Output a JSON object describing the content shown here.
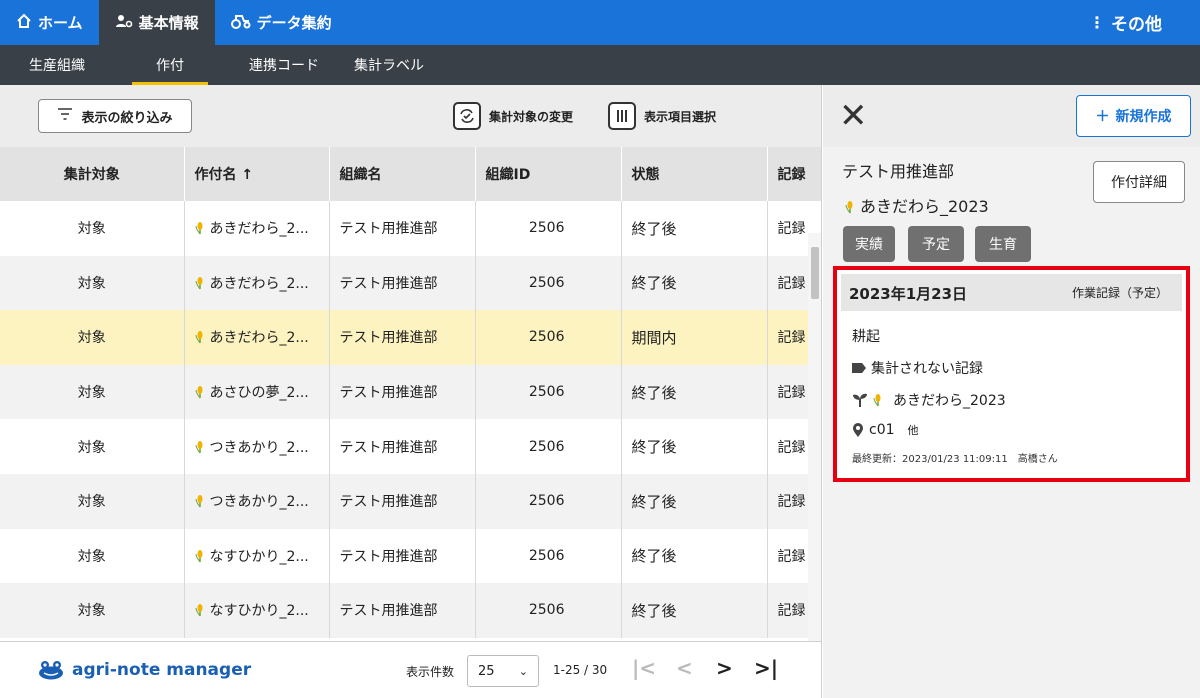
{
  "topnav": {
    "home": "ホーム",
    "basic_info": "基本情報",
    "data_summary": "データ集約",
    "more": "その他"
  },
  "subnav": [
    "生産組織",
    "作付",
    "連携コード",
    "集計ラベル"
  ],
  "toolbar": {
    "filter": "表示の絞り込み",
    "change_target": "集計対象の変更",
    "select_columns": "表示項目選択"
  },
  "table": {
    "headers": [
      "集計対象",
      "作付名 ↑",
      "組織名",
      "組織ID",
      "状態",
      "記録"
    ],
    "rows": [
      {
        "target": "対象",
        "crop": "あきだわら_2...",
        "org": "テスト用推進部",
        "id": "2506",
        "status": "終了後",
        "rec": "記録"
      },
      {
        "target": "対象",
        "crop": "あきだわら_2...",
        "org": "テスト用推進部",
        "id": "2506",
        "status": "終了後",
        "rec": "記録"
      },
      {
        "target": "対象",
        "crop": "あきだわら_2...",
        "org": "テスト用推進部",
        "id": "2506",
        "status": "期間内",
        "rec": "記録"
      },
      {
        "target": "対象",
        "crop": "あさひの夢_2...",
        "org": "テスト用推進部",
        "id": "2506",
        "status": "終了後",
        "rec": "記録"
      },
      {
        "target": "対象",
        "crop": "つきあかり_2...",
        "org": "テスト用推進部",
        "id": "2506",
        "status": "終了後",
        "rec": "記録"
      },
      {
        "target": "対象",
        "crop": "つきあかり_2...",
        "org": "テスト用推進部",
        "id": "2506",
        "status": "終了後",
        "rec": "記録"
      },
      {
        "target": "対象",
        "crop": "なすひかり_2...",
        "org": "テスト用推進部",
        "id": "2506",
        "status": "終了後",
        "rec": "記録"
      },
      {
        "target": "対象",
        "crop": "なすひかり_2...",
        "org": "テスト用推進部",
        "id": "2506",
        "status": "終了後",
        "rec": "記録"
      }
    ]
  },
  "footer": {
    "logo": "agri-note manager",
    "per_page_label": "表示件数",
    "per_page": "25",
    "range": "1-25 / 30"
  },
  "panel": {
    "new_button": "新規作成",
    "org": "テスト用推進部",
    "crop": "あきだわら_2023",
    "detail_button": "作付詳細",
    "chips": [
      "実績",
      "予定",
      "生育"
    ],
    "card": {
      "date": "2023年1月23日",
      "type": "作業記録（予定）",
      "task": "耕起",
      "label": "集計されない記録",
      "crop": "あきだわら_2023",
      "field": "c01",
      "field_more": "他",
      "updated": "最終更新：2023/01/23 11:09:11　高橋さん"
    }
  },
  "colors": {
    "nav_blue": "#1a73d9",
    "subnav_dark": "#3a4048",
    "tab_underline": "#f2c200",
    "highlight_row": "#fdf3c0",
    "card_border": "#e60012",
    "chip_gray": "#707070"
  }
}
